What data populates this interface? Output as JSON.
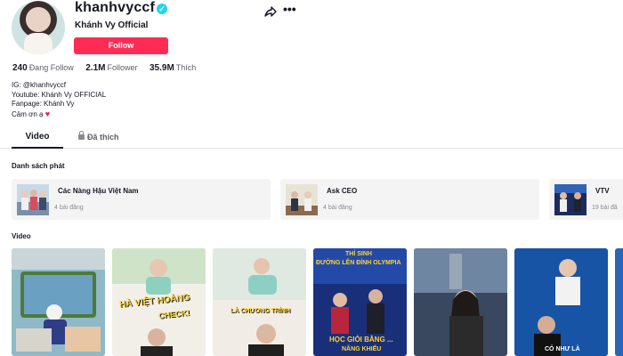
{
  "profile": {
    "username": "khanhvyccf",
    "nickname": "Khánh Vy Official",
    "follow_label": "Follow"
  },
  "stats": [
    {
      "value": "240",
      "label": "Đang Follow"
    },
    {
      "value": "2.1M",
      "label": "Follower"
    },
    {
      "value": "35.9M",
      "label": "Thích"
    }
  ],
  "bio": {
    "line1": "IG: @khanhvyccf",
    "line2": "Youtube: Khánh Vy OFFICIAL",
    "line3": "Fanpage: Khánh Vy",
    "line4": "Cảm ơn ạ"
  },
  "tabs": {
    "video": "Video",
    "liked": "Đã thích"
  },
  "playlists_title": "Danh sách phát",
  "playlists": [
    {
      "name": "Các Nàng Hậu Việt Nam",
      "count": "4 bài đăng"
    },
    {
      "name": "Ask CEO",
      "count": "4 bài đăng"
    },
    {
      "name": "VTV",
      "count": "19 bài đă"
    }
  ],
  "videos_title": "Video",
  "video_texts": {
    "v2": "HÀ VIỆT HOÀNG",
    "v2b": "CHECK!",
    "v3": "LÀ CHƯƠNG TRÌNH",
    "v4a": "THÍ SINH",
    "v4b": "ĐƯỜNG LÊN ĐỈNH OLYMPIA",
    "v4c": "HỌC GIỎI BẰNG ...",
    "v4d": "NĂNG KHIẾU",
    "v6": "CÓ NHƯ LÀ"
  },
  "icons": [
    "verified-icon",
    "share-icon",
    "more-icon",
    "lock-icon",
    "heart-icon"
  ],
  "colors": {
    "follow_button": "#fe2c55",
    "verified": "#20d5ec",
    "heart": "#e5222c",
    "playlist_bg": "#f4f4f5"
  }
}
